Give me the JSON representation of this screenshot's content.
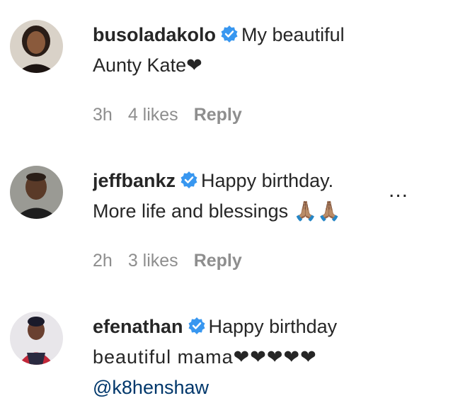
{
  "comments": [
    {
      "username": "busoladakolo",
      "verified": true,
      "line1": "My beautiful",
      "line2": "Aunty Kate❤",
      "time": "3h",
      "likes": "4 likes",
      "reply": "Reply"
    },
    {
      "username": "jeffbankz",
      "verified": true,
      "line1": "Happy birthday.",
      "line2": "More life and blessings 🙏🏽🙏🏽",
      "time": "2h",
      "likes": "3 likes",
      "reply": "Reply",
      "more": "..."
    },
    {
      "username": "efenathan",
      "verified": true,
      "line1": "Happy birthday",
      "line2": "beautiful mama❤❤❤❤❤",
      "mention": "@k8henshaw"
    }
  ],
  "colors": {
    "verified_blue": "#3897f0",
    "meta_gray": "#8e8e8e",
    "mention_blue": "#00376b"
  }
}
